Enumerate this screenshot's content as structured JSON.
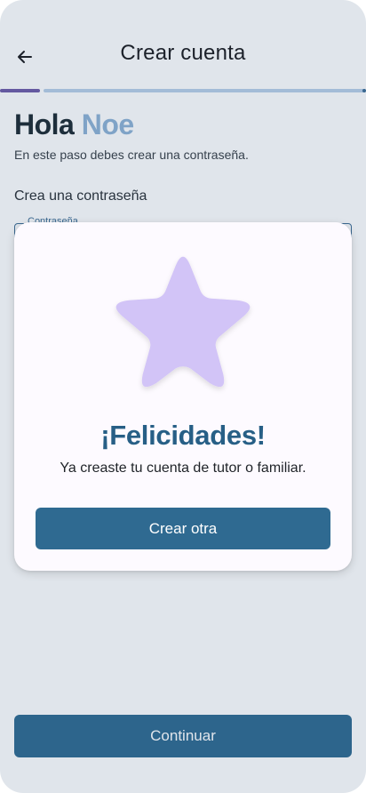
{
  "appbar": {
    "title": "Crear cuenta",
    "back_icon": "arrow-left-icon"
  },
  "progress": {
    "value": 0.11
  },
  "greeting": {
    "hello": "Hola",
    "name": "Noe"
  },
  "step_text": "En este paso debes crear una contraseña.",
  "section_label": "Crea una contraseña",
  "password_field": {
    "label": "Contraseña"
  },
  "continue_button": {
    "label": "Continuar"
  },
  "dialog": {
    "icon": "star-icon",
    "title": "¡Felicidades!",
    "message": "Ya creaste tu cuenta de tutor o familiar.",
    "button_label": "Crear otra"
  },
  "colors": {
    "primary": "#2f6a91",
    "title_blue": "#275f86",
    "star": "#d2c4f7",
    "name_accent": "#8fb3d6",
    "progress_done": "#6f5ca8",
    "progress_rest": "#b9d0e8"
  }
}
